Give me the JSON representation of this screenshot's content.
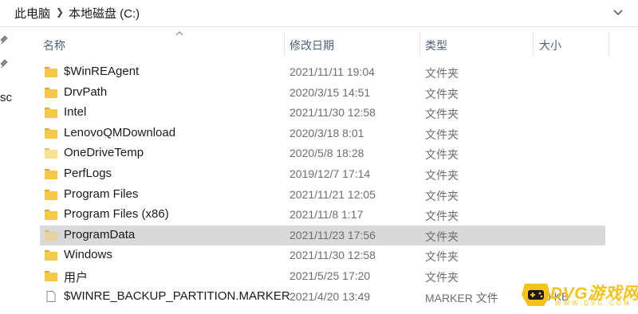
{
  "breadcrumb": {
    "root": "此电脑",
    "current": "本地磁盘 (C:)"
  },
  "nav": {
    "cut_text": "sc"
  },
  "columns": {
    "name": "名称",
    "date": "修改日期",
    "type": "类型",
    "size": "大小"
  },
  "files": [
    {
      "name": "$WinREAgent",
      "date": "2021/11/11 19:04",
      "type": "文件夹",
      "size": "",
      "kind": "folder"
    },
    {
      "name": "DrvPath",
      "date": "2020/3/15 14:51",
      "type": "文件夹",
      "size": "",
      "kind": "folder"
    },
    {
      "name": "Intel",
      "date": "2021/11/30 12:58",
      "type": "文件夹",
      "size": "",
      "kind": "folder"
    },
    {
      "name": "LenovoQMDownload",
      "date": "2020/3/18 8:01",
      "type": "文件夹",
      "size": "",
      "kind": "folder"
    },
    {
      "name": "OneDriveTemp",
      "date": "2020/5/8 18:28",
      "type": "文件夹",
      "size": "",
      "kind": "folder"
    },
    {
      "name": "PerfLogs",
      "date": "2019/12/7 17:14",
      "type": "文件夹",
      "size": "",
      "kind": "folder"
    },
    {
      "name": "Program Files",
      "date": "2021/11/21 12:05",
      "type": "文件夹",
      "size": "",
      "kind": "folder"
    },
    {
      "name": "Program Files (x86)",
      "date": "2021/11/8 1:17",
      "type": "文件夹",
      "size": "",
      "kind": "folder"
    },
    {
      "name": "ProgramData",
      "date": "2021/11/23 17:56",
      "type": "文件夹",
      "size": "",
      "kind": "folder",
      "selected": true
    },
    {
      "name": "Windows",
      "date": "2021/11/30 12:58",
      "type": "文件夹",
      "size": "",
      "kind": "folder"
    },
    {
      "name": "用户",
      "date": "2021/5/25 17:20",
      "type": "文件夹",
      "size": "",
      "kind": "folder"
    },
    {
      "name": "$WINRE_BACKUP_PARTITION.MARKER",
      "date": "2021/4/20 13:49",
      "type": "MARKER 文件",
      "size": "0 KB",
      "kind": "file"
    }
  ],
  "watermark": {
    "text": "DVG游戏网",
    "sub": "WWW.DVG.COM"
  },
  "colors": {
    "folder": "#f7c948",
    "selected_row": "#d9d9d9",
    "header_text": "#4c607a",
    "watermark": "#f6c21a"
  }
}
